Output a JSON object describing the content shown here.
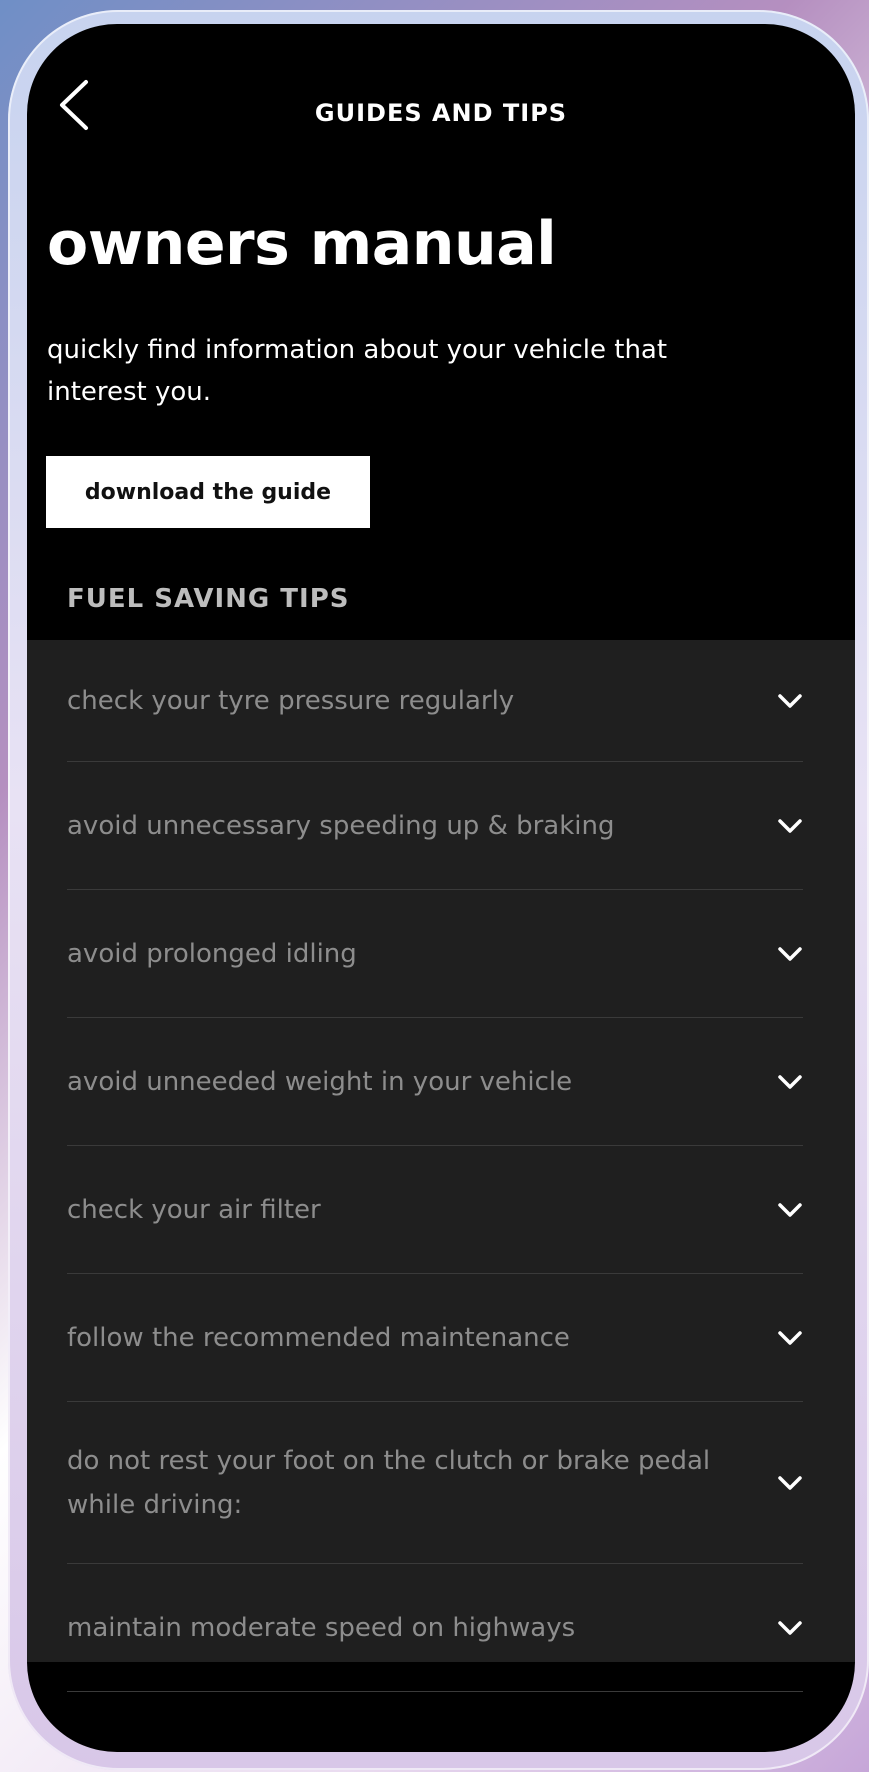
{
  "header": {
    "title": "GUIDES AND TIPS"
  },
  "page": {
    "title": "owners manual",
    "description": "quickly find information about your vehicle that interest you.",
    "download_button": "download the guide"
  },
  "fuel_tips": {
    "section_label": "FUEL  SAVING TIPS",
    "items": [
      {
        "label": "check your tyre pressure regularly"
      },
      {
        "label": "avoid unnecessary speeding up & braking"
      },
      {
        "label": "avoid prolonged idling"
      },
      {
        "label": "avoid unneeded weight in your vehicle"
      },
      {
        "label": "check your air filter"
      },
      {
        "label": "follow the recommended maintenance"
      },
      {
        "label": "do not rest your foot on the clutch or brake pedal while driving:"
      },
      {
        "label": "maintain moderate speed on highways"
      }
    ]
  },
  "colors": {
    "background": "#000000",
    "panel": "#1f1f1f",
    "primary_text": "#ffffff",
    "muted_text": "#8d8d8d",
    "button_bg": "#ffffff"
  },
  "icons": {
    "back": "chevron-left-icon",
    "expand": "chevron-down-icon"
  }
}
